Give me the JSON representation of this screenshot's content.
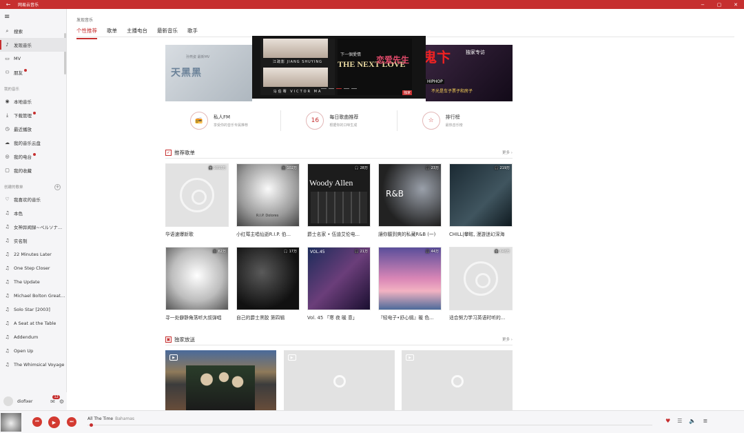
{
  "titlebar": {
    "title": "网易云音乐",
    "back": "←",
    "min": "−",
    "max": "▢",
    "close": "✕"
  },
  "sidebar": {
    "menu_icon": "≡",
    "main": [
      {
        "label": "搜索",
        "icon": "search-icon",
        "glyph": "⌕"
      },
      {
        "label": "发现音乐",
        "icon": "music-note-icon",
        "glyph": "♪",
        "active": true
      },
      {
        "label": "MV",
        "icon": "video-icon",
        "glyph": "▭"
      },
      {
        "label": "朋友",
        "icon": "friends-icon",
        "glyph": "⚇",
        "dot": true
      }
    ],
    "my_music_header": "我的音乐",
    "my_music": [
      {
        "label": "本地音乐",
        "glyph": "◉"
      },
      {
        "label": "下载管理",
        "glyph": "⤓",
        "dot": true
      },
      {
        "label": "最近播放",
        "glyph": "◷"
      },
      {
        "label": "我的音乐云盘",
        "glyph": "☁"
      },
      {
        "label": "我的电台",
        "glyph": "◎",
        "dot": true
      },
      {
        "label": "我的收藏",
        "glyph": "▢"
      }
    ],
    "playlists_header": "创建的歌单",
    "playlists": [
      "我喜欢的音乐",
      "本色",
      "女神异闻録~ペルソナ...",
      "实名制",
      "22 Minutes Later",
      "One Step Closer",
      "The Update",
      "Michael Bolton Greate...",
      "Solo Star [2003]",
      "A Seat at the Table",
      "Addendum",
      "Open Up",
      "The Whimsical Voyage"
    ],
    "user": {
      "name": "diofixer",
      "mail_count": "12"
    }
  },
  "main": {
    "breadcrumb": "发现音乐",
    "tabs": [
      "个性推荐",
      "歌单",
      "主播电台",
      "最新音乐",
      "歌手"
    ],
    "banner": {
      "left_small": "孙燕姿   最新MV",
      "left_big": "天黑黑",
      "p1_top": "江疏影 JIANG SHUYING",
      "p1_bottom": "马伯骞 VICTOR MA",
      "p2_small": "下一個愛情",
      "p2_big": "THE NEXT LOVE",
      "p2_red": "恋爱先生",
      "p2_tag": "独家",
      "right_exclusive": "独家专访",
      "right_big": "鬼卞",
      "right_hiphop": "HIPHOP",
      "right_quote": "不光是车子票子和房子"
    },
    "features": [
      {
        "name": "私人FM",
        "sub": "享受你的音乐专属推荐",
        "glyph": "📻"
      },
      {
        "name": "每日歌曲推荐",
        "sub": "根据你的口味生成",
        "glyph": "16"
      },
      {
        "name": "排行榜",
        "sub": "最热音乐榜",
        "glyph": "☆"
      }
    ],
    "rec_section": {
      "title": "推荐歌单",
      "more": "更多 ›"
    },
    "playlists_row1": [
      {
        "title": "华语速爆新歌",
        "plays": "9893万"
      },
      {
        "title": "小红莓主唱仙逝R.I.P. 伯...",
        "plays": "102万",
        "cover_text": "R.I.P. Dolores"
      },
      {
        "title": "爵士名家 • 伍迪艾伦电...",
        "plays": "28万",
        "cover_text": "Woody Allen"
      },
      {
        "title": "讓你聽到爽的私藏R&B (一)",
        "plays": "23万",
        "cover_text": "R&B"
      },
      {
        "title": "CHILL|攀眩, 漫游迷幻深海",
        "plays": "219万"
      }
    ],
    "playlists_row2": [
      {
        "title": "寻一处僻静角落听大叔弹唱",
        "plays": "62万"
      },
      {
        "title": "自己的爵士黑胶 第四辑",
        "plays": "17万"
      },
      {
        "title": "Vol. 45 「寒 夜 暖 意」",
        "plays": "21万",
        "cover_text": "VOL.45"
      },
      {
        "title": "『轻电子•舒心辑』暖 色...",
        "plays": "44万"
      },
      {
        "title": "适合努力学习英语时听的...",
        "plays": "648万"
      }
    ],
    "exclusive_section": {
      "title": "独家放送",
      "more": "更多 ›"
    }
  },
  "player": {
    "song": "All The Time",
    "artist": "Bahamas",
    "prev": "⏮",
    "play": "▶",
    "next": "⏭",
    "progress": 0.004
  }
}
